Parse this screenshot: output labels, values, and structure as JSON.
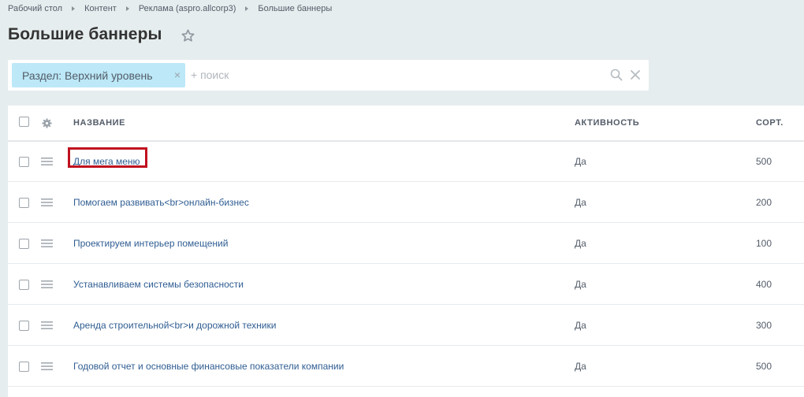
{
  "breadcrumb": [
    {
      "label": "Рабочий стол"
    },
    {
      "label": "Контент"
    },
    {
      "label": "Реклама (aspro.allcorp3)"
    },
    {
      "label": "Большие баннеры"
    }
  ],
  "page_title": "Большие баннеры",
  "filter": {
    "chip_label": "Раздел: Верхний уровень",
    "chip_close": "×",
    "search_placeholder": "+ поиск"
  },
  "table": {
    "columns": {
      "name": "НАЗВАНИЕ",
      "active": "АКТИВНОСТЬ",
      "sort": "СОРТ."
    },
    "rows": [
      {
        "name": "Для мега меню",
        "active": "Да",
        "sort": "500"
      },
      {
        "name": "Помогаем развивать<br>онлайн-бизнес",
        "active": "Да",
        "sort": "200"
      },
      {
        "name": "Проектируем интерьер помещений",
        "active": "Да",
        "sort": "100"
      },
      {
        "name": "Устанавливаем системы безопасности",
        "active": "Да",
        "sort": "400"
      },
      {
        "name": "Аренда строительной<br>и дорожной техники",
        "active": "Да",
        "sort": "300"
      },
      {
        "name": "Годовой отчет и основные финансовые показатели компании",
        "active": "Да",
        "sort": "500"
      }
    ]
  },
  "colors": {
    "page_bg": "#e6edee",
    "link": "#2f5d92",
    "chip_bg": "#bce8f7",
    "highlight": "#c0101e"
  }
}
